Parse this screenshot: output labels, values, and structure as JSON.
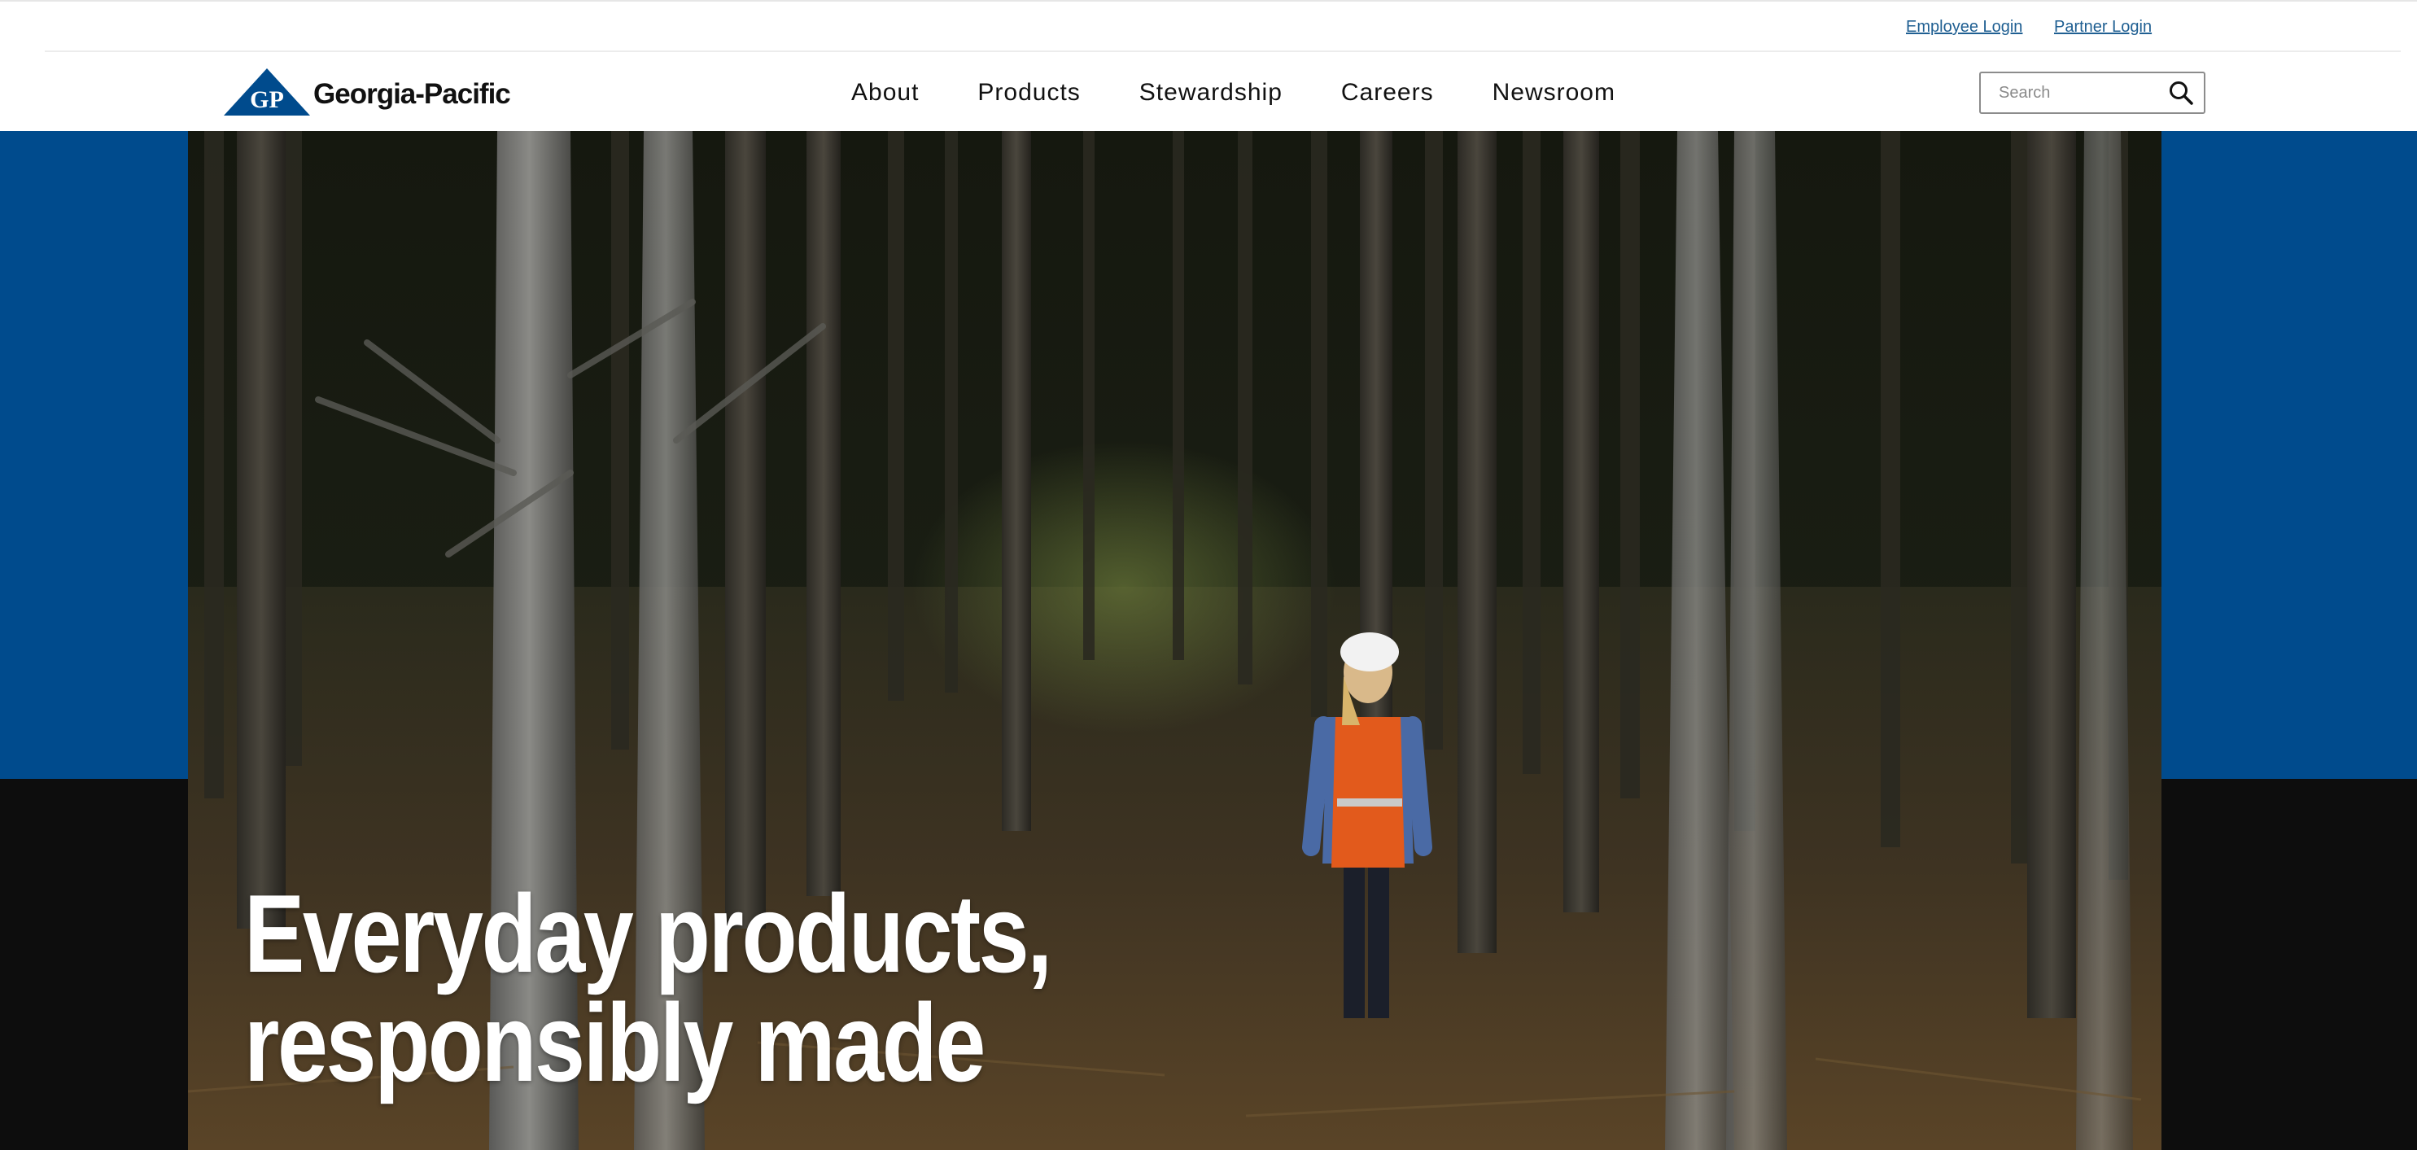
{
  "utility": {
    "employee_login": "Employee Login",
    "partner_login": "Partner Login"
  },
  "header": {
    "logo_monogram": "GP",
    "logo_wordmark": "Georgia-Pacific",
    "nav": [
      {
        "label": "About"
      },
      {
        "label": "Products"
      },
      {
        "label": "Stewardship"
      },
      {
        "label": "Careers"
      },
      {
        "label": "Newsroom"
      }
    ],
    "search": {
      "placeholder": "Search",
      "icon": "search-icon"
    }
  },
  "hero": {
    "headline_line1": "Everyday products,",
    "headline_line2": "responsibly made",
    "image": "forest-worker-photo"
  },
  "colors": {
    "brand_blue": "#004b8d",
    "link_blue": "#1f5f92",
    "hero_dark": "#0d0d0d",
    "text": "#111111"
  }
}
